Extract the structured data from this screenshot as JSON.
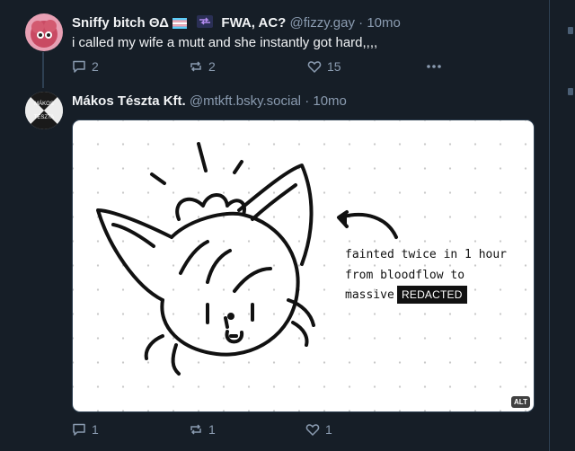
{
  "post1": {
    "display_name": "Sniffy bitch ΘΔ",
    "name_suffix": "FWA, AC?",
    "handle": "@fizzy.gay",
    "time": "10mo",
    "text": "i called my wife a mutt and she instantly got hard,,,,",
    "replies": "2",
    "reposts": "2",
    "likes": "15"
  },
  "post2": {
    "display_name": "Mákos Tészta Kft.",
    "handle": "@mtkft.bsky.social",
    "time": "10mo",
    "avatar_text_top": "MÁKOS",
    "avatar_text_bottom": "TÉSZTA",
    "image_text_line1": "fainted twice in 1 hour",
    "image_text_line2": "from bloodflow to",
    "image_text_line3": "massive",
    "image_redacted": "REDACTED",
    "alt_badge": "ALT",
    "replies": "1",
    "reposts": "1",
    "likes": "1"
  },
  "colors": {
    "background": "#161e27",
    "muted_text": "#8a9bb0",
    "border": "#2e4052"
  },
  "icons": [
    "reply-icon",
    "repost-icon",
    "like-icon",
    "more-icon",
    "trans-flag-icon",
    "soon-arrow-icon"
  ]
}
